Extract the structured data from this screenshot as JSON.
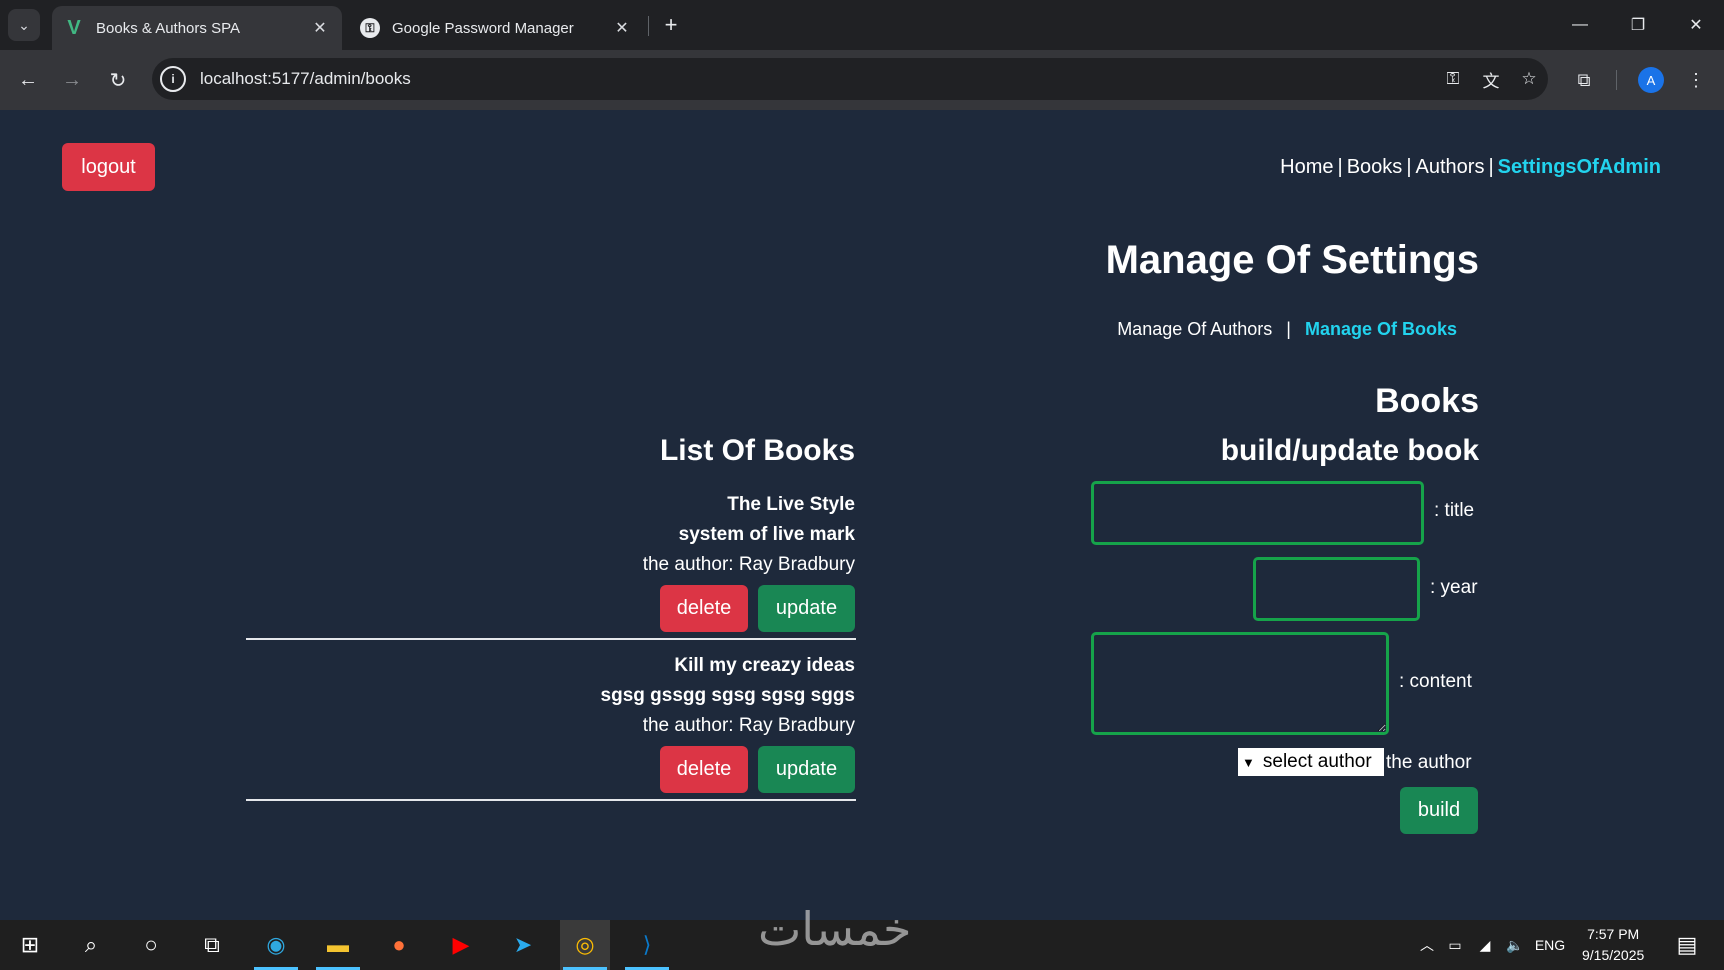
{
  "browser": {
    "tabs": [
      {
        "title": "Books & Authors SPA",
        "active": true
      },
      {
        "title": "Google Password Manager",
        "active": false
      }
    ],
    "url": "localhost:5177/admin/books",
    "profile_initial": "A"
  },
  "header": {
    "logout_label": "logout",
    "nav": [
      {
        "label": "Home",
        "active": false
      },
      {
        "label": "Books",
        "active": false
      },
      {
        "label": "Authors",
        "active": false
      },
      {
        "label": "SettingsOfAdmin",
        "active": true
      }
    ],
    "separator": "|"
  },
  "settings": {
    "title": "Manage Of Settings",
    "subnav": [
      {
        "label": "Manage Of Authors",
        "active": false
      },
      {
        "label": "Manage Of Books",
        "active": true
      }
    ],
    "separator": "|"
  },
  "form": {
    "section_title": "Books",
    "form_title": "build/update book",
    "title_label": ": title",
    "title_value": "",
    "year_label": ": year",
    "year_value": "",
    "content_label": ": content",
    "content_value": "",
    "select_placeholder": "select author",
    "author_label": "the author",
    "build_label": "build"
  },
  "list": {
    "title": "List Of Books",
    "delete_label": "delete",
    "update_label": "update",
    "books": [
      {
        "title": "The Live Style",
        "content": "system of live mark",
        "author": "the author: Ray Bradbury"
      },
      {
        "title": "Kill my creazy ideas",
        "content": "sgsg gssgg sgsg sgsg sggs",
        "author": "the author: Ray Bradbury"
      }
    ]
  },
  "taskbar": {
    "watermark": "خمسات",
    "language": "ENG",
    "time": "7:57 PM",
    "date": "9/15/2025"
  },
  "colors": {
    "page_bg": "#1e293b",
    "accent_cyan": "#22d3ee",
    "danger": "#dc3545",
    "success": "#198754",
    "input_border": "#16a34a"
  }
}
